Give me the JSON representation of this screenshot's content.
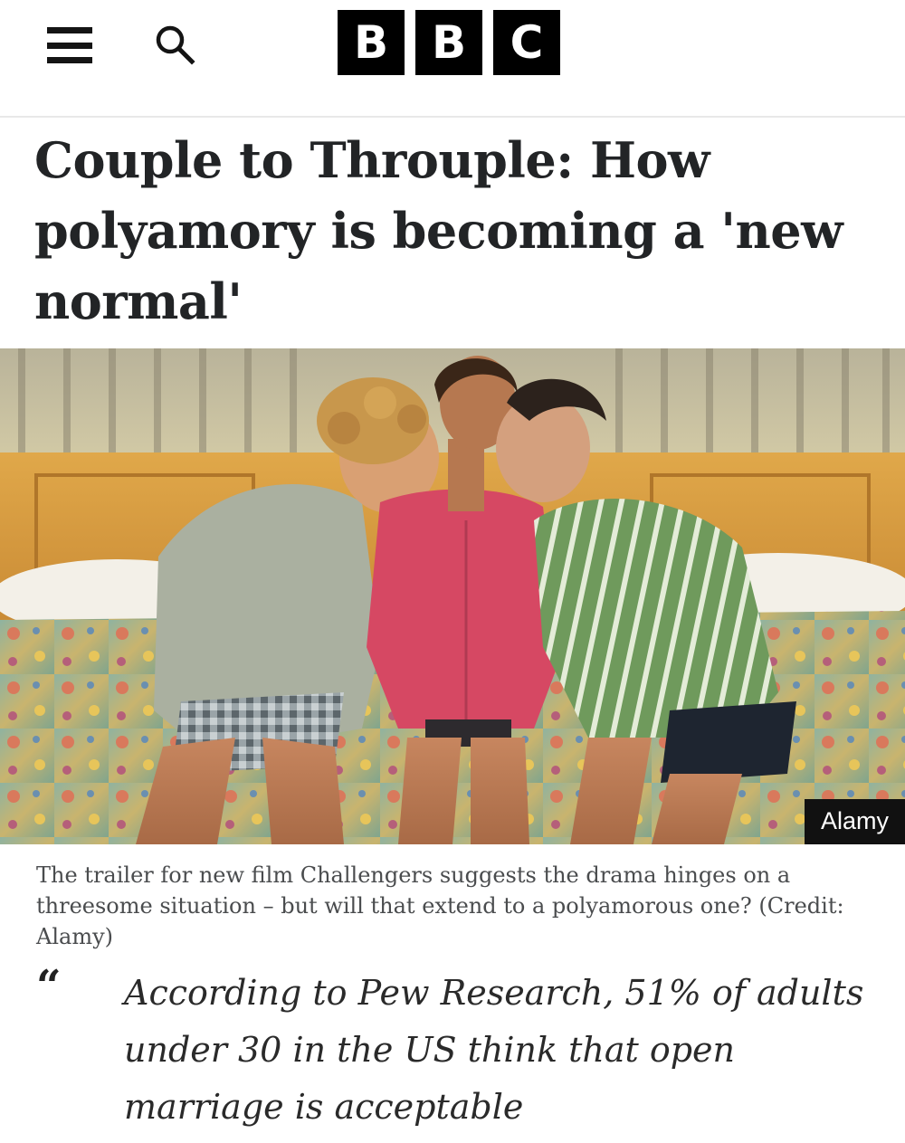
{
  "header": {
    "menu_icon": "hamburger-menu-icon",
    "search_icon": "search-icon",
    "logo_letters": [
      "B",
      "B",
      "C"
    ]
  },
  "article": {
    "headline": "Couple to Throuple: How polyamory is becoming a 'new normal'",
    "hero_image": {
      "description_icon": "hero-photo",
      "credit_badge": "Alamy"
    },
    "caption": "The trailer for new film Challengers suggests the drama hinges on a threesome situation – but will that extend to a polyamorous one? (Credit: Alamy)",
    "pull_quote": {
      "mark": "“",
      "text": "According to Pew Research, 51% of adults under 30 in the US think that open marriage is acceptable"
    }
  },
  "colors": {
    "logo_bg": "#000000",
    "logo_fg": "#ffffff",
    "headline": "#222426",
    "caption": "#4a4c4e",
    "badge_bg": "#111111"
  }
}
